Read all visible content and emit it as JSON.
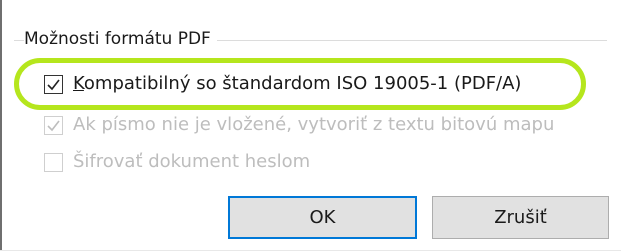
{
  "group": {
    "title": "Možnosti formátu PDF"
  },
  "options": [
    {
      "accel": "K",
      "rest": "ompatibilný so štandardom ISO 19005-1 (PDF/A)",
      "checked": true,
      "enabled": true
    },
    {
      "accel": "",
      "rest": "Ak písmo nie je vložené, vytvoriť z textu bitovú mapu",
      "checked": true,
      "enabled": false
    },
    {
      "accel": "",
      "rest": "Šifrovať dokument heslom",
      "checked": false,
      "enabled": false
    }
  ],
  "buttons": {
    "ok": "OK",
    "cancel": "Zrušiť"
  },
  "colors": {
    "highlight": "#b5e61d",
    "focus_border": "#0078d7",
    "disabled_text": "#bdbdbd"
  }
}
